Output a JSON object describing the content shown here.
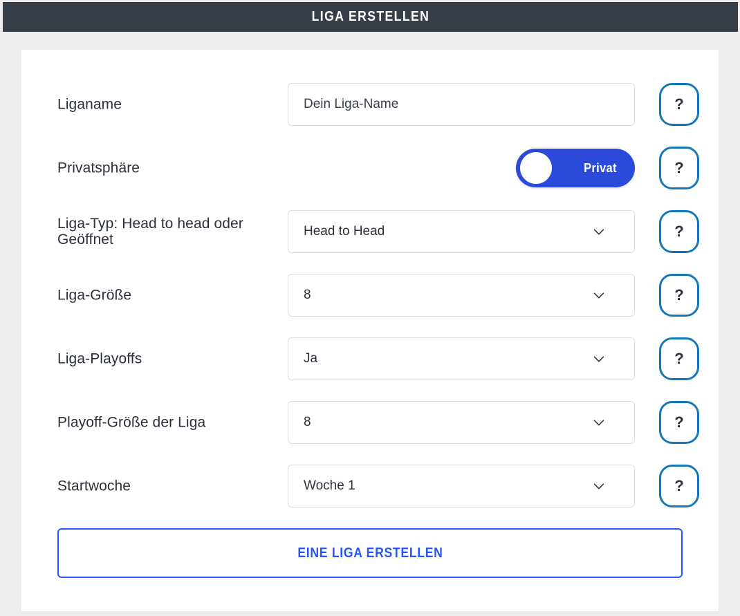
{
  "header": {
    "title": "LIGA ERSTELLEN",
    "background_color": "#383e48",
    "text_color": "#ffffff"
  },
  "theme": {
    "page_background": "#eeecec",
    "card_background": "#ffffff",
    "label_color": "#2b303b",
    "input_border": "#dddddd",
    "help_border": "#1277b6",
    "toggle_on_color": "#2b4ad9",
    "submit_accent": "#2555f5"
  },
  "form": {
    "rows": [
      {
        "label": "Liganame",
        "control": "text",
        "value": "Dein Liga-Name",
        "placeholder": "Dein Liga-Name",
        "help_label": "?"
      },
      {
        "label": "Privatsphäre",
        "control": "toggle",
        "value": "Privat",
        "state": "on",
        "help_label": "?"
      },
      {
        "label": "Liga-Typ: Head to head oder Geöffnet",
        "control": "select",
        "value": "Head to Head",
        "help_label": "?"
      },
      {
        "label": "Liga-Größe",
        "control": "select",
        "value": "8",
        "help_label": "?"
      },
      {
        "label": "Liga-Playoffs",
        "control": "select",
        "value": "Ja",
        "help_label": "?"
      },
      {
        "label": "Playoff-Größe der Liga",
        "control": "select",
        "value": "8",
        "help_label": "?"
      },
      {
        "label": "Startwoche",
        "control": "select",
        "value": "Woche 1",
        "help_label": "?"
      }
    ],
    "submit_label": "EINE LIGA ERSTELLEN"
  }
}
